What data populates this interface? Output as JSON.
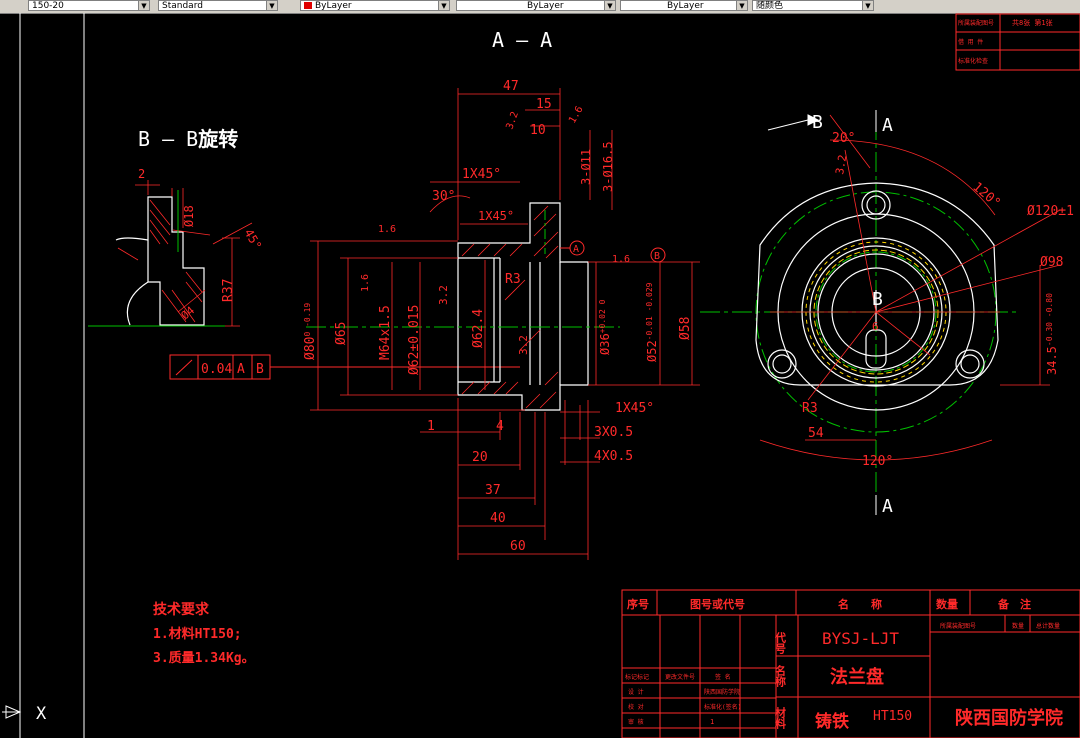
{
  "toolbar": {
    "linetype_scale": "150-20",
    "text_style": "Standard",
    "color": "ByLayer",
    "linetype": "ByLayer",
    "lineweight": "ByLayer",
    "plot_style": "随颜色"
  },
  "drawing": {
    "section_aa": "A — A",
    "section_bb": "B — B",
    "section_bb_suffix": "旋转",
    "dims": {
      "d47": "47",
      "d15": "15",
      "d10": "10",
      "d16a": "1.6",
      "d32a": "3.2",
      "d3_11": "3-Ø11",
      "d3_165": "3-Ø16.5",
      "d1x45a": "1X45°",
      "d1x45b": "1X45°",
      "d30": "30°",
      "d2": "2",
      "d18": "Ø18",
      "d45": "45°",
      "r37": "R37",
      "d4": "Ø4",
      "d16b": "1.6",
      "d16c": "1.6",
      "d16d": "1.6",
      "d32b": "3.2",
      "d32c": "3.2",
      "d32d": "3.2",
      "d80": "Ø80",
      "d80tol": "0 -0.19",
      "d65": "Ø65",
      "m64": "M64x1.5",
      "d62": "Ø62±0.015",
      "d624": "Ø62.4",
      "r3a": "R3",
      "d36": "Ø36",
      "d36tol": "+0.02 0",
      "d52": "Ø52",
      "d52tol": "-0.01 -0.029",
      "d58": "Ø58",
      "d1": "1",
      "d4b": "4",
      "d20": "20",
      "d37": "37",
      "d40": "40",
      "d60": "60",
      "d1x45c": "1X45°",
      "d3x05": "3X0.5",
      "d4x05": "4X0.5",
      "tol_value": "0.04",
      "tol_a": "A",
      "tol_b": "B",
      "datum_a": "A",
      "datum_b": "B",
      "d20deg": "20°",
      "d120deg": "120°",
      "d120b": "120°",
      "d120pm": "Ø120±1",
      "d98": "Ø98",
      "d345": "34.5",
      "d345tol": "-0.30 -0.80",
      "d54": "54",
      "r3b": "R3",
      "d6": "6",
      "b_lbl1": "B",
      "b_lbl2": "B",
      "a_lbl1": "A",
      "a_lbl2": "A",
      "d32e": "3.2"
    },
    "notes": {
      "title": "技术要求",
      "line1": "1.材料HT150;",
      "line2": "3.质量1.34Kg。"
    },
    "title_block": {
      "col_seq": "序号",
      "col_code": "图号或代号",
      "col_name": "名　　称",
      "col_qty": "数量",
      "col_remark": "备　注",
      "lbl_code": "代号",
      "lbl_name": "名称",
      "lbl_material": "材料",
      "code_value": "BYSJ-LJT",
      "name_value": "法兰盘",
      "material_value": "铸铁",
      "material_grade": "HT150",
      "school": "陕西国防学院",
      "mini1": "所属装配图号",
      "mini2": "数量",
      "mini3": "总计数量",
      "small_a": "标记标记",
      "small_b": "更改文件号",
      "small_c": "签 名",
      "small_d": "设 计",
      "small_e": "校 对",
      "small_f": "审 核",
      "small_g": "陕西国防学院",
      "small_h": "标准化(签名)",
      "small_i": "1"
    },
    "corner_table": {
      "r1": "所属装配图号",
      "r1v": "共8张 第1张",
      "r2": "借 用 件",
      "r3": "标准化检查"
    },
    "ucs_x": "X"
  }
}
